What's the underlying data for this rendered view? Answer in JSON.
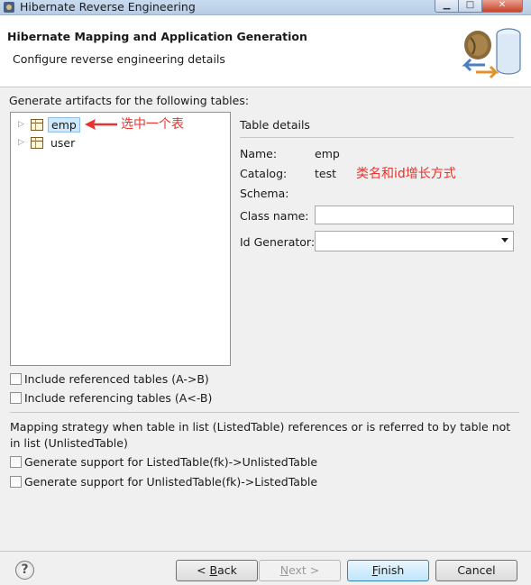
{
  "window": {
    "title": "Hibernate Reverse Engineering"
  },
  "header": {
    "title": "Hibernate Mapping and Application Generation",
    "subtitle": "Configure reverse engineering details"
  },
  "tables_section": {
    "label": "Generate artifacts for the following tables:",
    "items": [
      {
        "name": "emp",
        "selected": true
      },
      {
        "name": "user",
        "selected": false
      }
    ]
  },
  "annotations": {
    "select_one": "选中一个表",
    "class_and_id": "类名和id增长方式",
    "color": "#e8322b"
  },
  "details": {
    "title": "Table details",
    "name_label": "Name:",
    "name_value": "emp",
    "catalog_label": "Catalog:",
    "catalog_value": "test",
    "schema_label": "Schema:",
    "class_name_label": "Class name:",
    "class_name_value": "",
    "id_generator_label": "Id Generator:",
    "id_generator_value": ""
  },
  "options": {
    "include_referenced": {
      "label": "Include referenced tables (A->B)",
      "checked": false
    },
    "include_referencing": {
      "label": "Include referencing tables (A<-B)",
      "checked": false
    }
  },
  "strategy": {
    "text": "Mapping strategy when table in list (ListedTable) references or is referred to by table not in list (UnlistedTable)",
    "listed_to_unlisted": {
      "label": "Generate support for ListedTable(fk)->UnlistedTable",
      "checked": false
    },
    "unlisted_to_listed": {
      "label": "Generate support for UnlistedTable(fk)->ListedTable",
      "checked": false
    }
  },
  "buttons": {
    "back_prefix": "< ",
    "back_mnemonic": "B",
    "back_rest": "ack",
    "next_mnemonic": "N",
    "next_rest": "ext >",
    "finish_mnemonic": "F",
    "finish_rest": "inish",
    "cancel": "Cancel"
  },
  "icons": {
    "help": "help-icon",
    "table": "table-icon",
    "expand": "tree-expand-icon",
    "dropdown": "chevron-down-icon"
  }
}
